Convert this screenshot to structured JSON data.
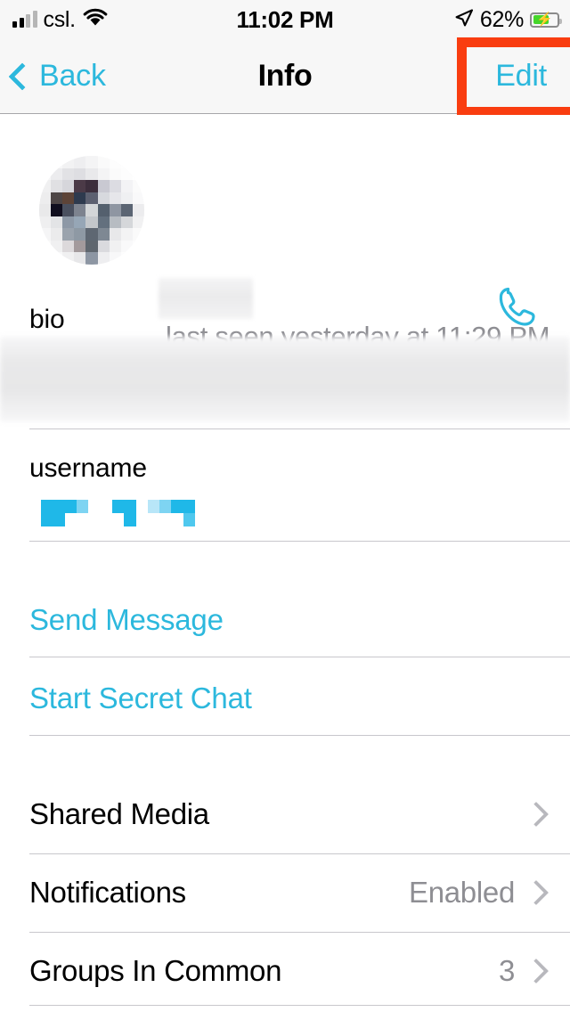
{
  "status_bar": {
    "carrier": "csl.",
    "time": "11:02 PM",
    "battery_percent": "62%",
    "battery_level": 62,
    "charging": true,
    "icons": {
      "signal": "signal-bars-icon",
      "wifi": "wifi-icon",
      "location": "location-arrow-icon",
      "battery": "battery-charging-icon"
    }
  },
  "nav_bar": {
    "back_label": "Back",
    "title": "Info",
    "edit_label": "Edit",
    "accent_color": "#2cb8dd",
    "background": "#f7f7f7",
    "highlight_color": "#f93d10",
    "highlight_target": "edit-button"
  },
  "profile": {
    "name": "",
    "name_redacted": true,
    "avatar_redacted": true,
    "status": "last seen yesterday at 11:29 PM",
    "call_icon": "phone-icon"
  },
  "sections": {
    "bio": {
      "label": "bio",
      "value": "",
      "redacted": true
    },
    "username": {
      "label": "username",
      "value": "",
      "redacted": true
    }
  },
  "actions": [
    {
      "label": "Send Message",
      "name": "send-message-row"
    },
    {
      "label": "Start Secret Chat",
      "name": "start-secret-chat-row"
    }
  ],
  "menu_rows": [
    {
      "label": "Shared Media",
      "value": "",
      "chevron": true
    },
    {
      "label": "Notifications",
      "value": "Enabled",
      "chevron": true
    },
    {
      "label": "Groups In Common",
      "value": "3",
      "chevron": true
    }
  ],
  "colors": {
    "accent": "#2cb8dd",
    "secondary_text": "#8e8e93",
    "divider": "#c8c7cc",
    "highlight": "#f93d10",
    "battery_green": "#45d62a"
  }
}
